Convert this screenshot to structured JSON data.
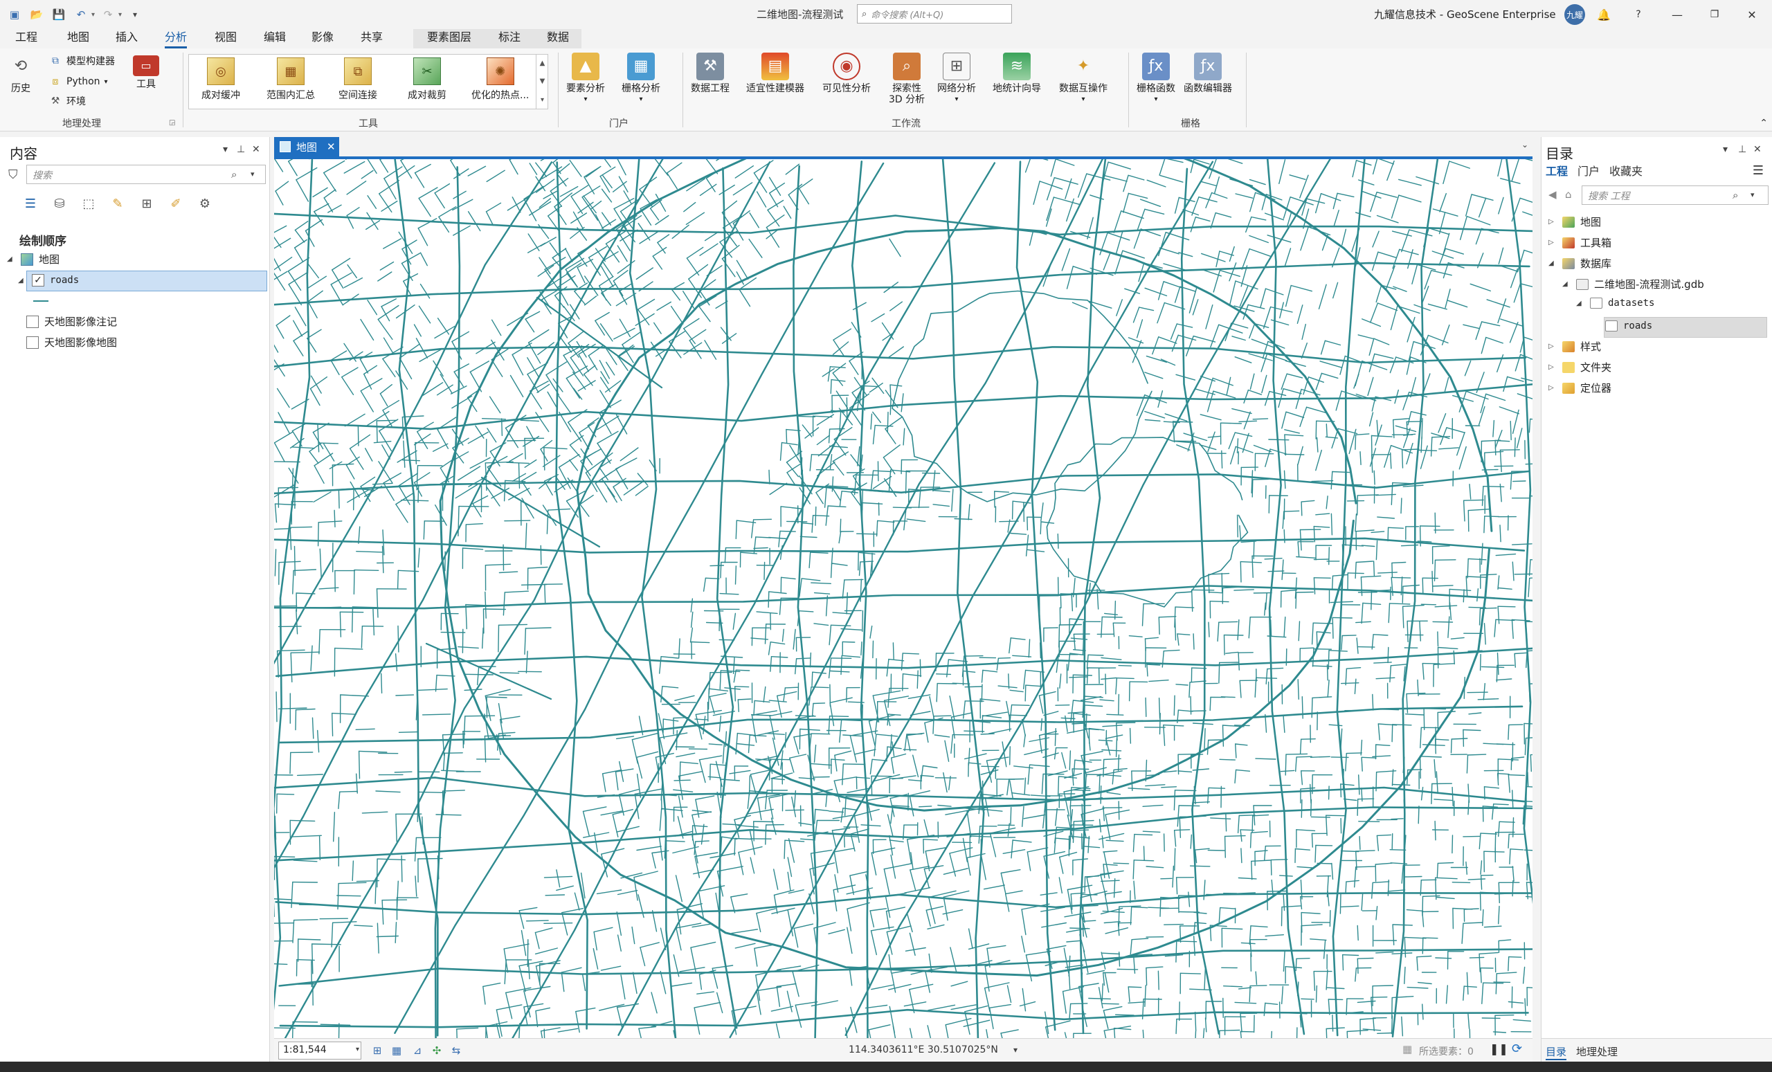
{
  "window": {
    "doc_title": "二维地图-流程测试",
    "command_search_placeholder": "命令搜索 (Alt+Q)",
    "org_name": "九耀信息技术 - GeoScene Enterprise",
    "user_avatar": "九耀",
    "help_label": "?",
    "notification_icon": "bell-icon"
  },
  "menu": {
    "tabs": [
      "工程",
      "地图",
      "插入",
      "分析",
      "视图",
      "编辑",
      "影像",
      "共享"
    ],
    "active_tab": "分析",
    "context_tabs": [
      "要素图层",
      "标注",
      "数据"
    ]
  },
  "ribbon": {
    "geoprocessing": {
      "history_label": "历史",
      "model_builder_label": "模型构建器",
      "python_label": "Python",
      "environments_label": "环境",
      "tools_label": "工具",
      "group_label": "地理处理"
    },
    "tools_gallery": {
      "items": [
        "成对缓冲",
        "范围内汇总",
        "空间连接",
        "成对裁剪",
        "优化的热点..."
      ],
      "group_label": "工具"
    },
    "portal": {
      "feature_analysis_label": "要素分析",
      "raster_analysis_label": "栅格分析",
      "group_label": "门户"
    },
    "workflows": {
      "data_engineering_label": "数据工程",
      "suitability_label": "适宜性建模器",
      "visibility_label": "可见性分析",
      "exploratory_label_1": "探索性",
      "exploratory_label_2": "3D 分析",
      "network_label": "网络分析",
      "geostat_label": "地统计向导",
      "interop_label": "数据互操作",
      "group_label": "工作流"
    },
    "raster": {
      "raster_functions_label": "栅格函数",
      "function_editor_label": "函数编辑器",
      "group_label": "栅格"
    }
  },
  "contents": {
    "title": "内容",
    "search_placeholder": "搜索",
    "draw_order_label": "绘制顺序",
    "map_label": "地图",
    "layers": [
      {
        "name": "roads",
        "checked": true
      },
      {
        "name": "天地图影像注记",
        "checked": false
      },
      {
        "name": "天地图影像地图",
        "checked": false
      }
    ],
    "roads_color": "#2e8a8f"
  },
  "map_view": {
    "tab_label": "地图",
    "road_color": "#2e8a8f",
    "scale": "1:81,544",
    "coordinates": "114.3403611°E 30.5107025°N",
    "selected_features": "所选要素：0"
  },
  "catalog": {
    "title": "目录",
    "tabs": [
      "工程",
      "门户",
      "收藏夹"
    ],
    "active_tab": "工程",
    "search_placeholder": "搜索 工程",
    "items": {
      "maps": "地图",
      "toolboxes": "工具箱",
      "databases": "数据库",
      "gdb": "二维地图-流程测试.gdb",
      "datasets": "datasets",
      "roads": "roads",
      "styles": "样式",
      "folders": "文件夹",
      "locators": "定位器"
    },
    "bottom_tabs": [
      "目录",
      "地理处理"
    ]
  }
}
